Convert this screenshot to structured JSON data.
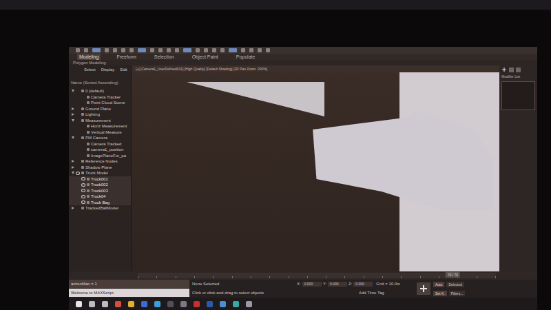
{
  "ribbon": {
    "tabs": [
      {
        "label": "Modeling",
        "selected": true
      },
      {
        "label": "Freeform",
        "selected": false
      },
      {
        "label": "Selection",
        "selected": false
      },
      {
        "label": "Object Paint",
        "selected": false
      },
      {
        "label": "Populate",
        "selected": false
      }
    ],
    "subtitle": "Polygon Modeling"
  },
  "scene_explorer": {
    "menu": [
      "Select",
      "Display",
      "Edit"
    ],
    "header": "Name (Sorted Ascending)",
    "items": [
      {
        "label": "0 (default)",
        "depth": 0,
        "expandable": true,
        "expanded": true,
        "selected": false,
        "visible": false
      },
      {
        "label": "Camera Tracker",
        "depth": 1,
        "expandable": false,
        "expanded": false,
        "selected": false,
        "visible": false
      },
      {
        "label": "Point Cloud Scene",
        "depth": 1,
        "expandable": false,
        "expanded": false,
        "selected": false,
        "visible": false
      },
      {
        "label": "Ground Plane",
        "depth": 0,
        "expandable": true,
        "expanded": false,
        "selected": false,
        "visible": false
      },
      {
        "label": "Lighting",
        "depth": 0,
        "expandable": true,
        "expanded": false,
        "selected": false,
        "visible": false
      },
      {
        "label": "Measurement",
        "depth": 0,
        "expandable": true,
        "expanded": true,
        "selected": false,
        "visible": false
      },
      {
        "label": "Horiz Measurement",
        "depth": 1,
        "expandable": false,
        "expanded": false,
        "selected": false,
        "visible": false
      },
      {
        "label": "Vertical Measure",
        "depth": 1,
        "expandable": false,
        "expanded": false,
        "selected": false,
        "visible": false
      },
      {
        "label": "PM Camera",
        "depth": 0,
        "expandable": true,
        "expanded": true,
        "selected": false,
        "visible": false
      },
      {
        "label": "Camera Tracked",
        "depth": 1,
        "expandable": false,
        "expanded": false,
        "selected": false,
        "visible": false
      },
      {
        "label": "camera1_position",
        "depth": 1,
        "expandable": false,
        "expanded": false,
        "selected": false,
        "visible": false
      },
      {
        "label": "ImagePlaneFor_pa",
        "depth": 1,
        "expandable": false,
        "expanded": false,
        "selected": false,
        "visible": false
      },
      {
        "label": "Reference Nodes",
        "depth": 0,
        "expandable": true,
        "expanded": false,
        "selected": false,
        "visible": false
      },
      {
        "label": "Shadow Plane",
        "depth": 0,
        "expandable": true,
        "expanded": false,
        "selected": false,
        "visible": false
      },
      {
        "label": "Truck Model",
        "depth": 0,
        "expandable": true,
        "expanded": true,
        "selected": false,
        "visible": true
      },
      {
        "label": "Truck001",
        "depth": 1,
        "expandable": false,
        "expanded": false,
        "selected": true,
        "visible": true
      },
      {
        "label": "Truck002",
        "depth": 1,
        "expandable": false,
        "expanded": false,
        "selected": true,
        "visible": true
      },
      {
        "label": "Truck003",
        "depth": 1,
        "expandable": false,
        "expanded": false,
        "selected": true,
        "visible": true
      },
      {
        "label": "Truck04",
        "depth": 1,
        "expandable": false,
        "expanded": false,
        "selected": true,
        "visible": true
      },
      {
        "label": "Truck Bag",
        "depth": 1,
        "expandable": false,
        "expanded": false,
        "selected": true,
        "visible": true
      },
      {
        "label": "TrackedBallModel",
        "depth": 0,
        "expandable": true,
        "expanded": false,
        "selected": false,
        "visible": false
      }
    ]
  },
  "viewport": {
    "label": "[+] [Camera1_UserDefined001] [High Quality] [Default Shading] [2D Pan Zoom: 200%]"
  },
  "command_panel": {
    "heading": "Modifier List"
  },
  "timeline": {
    "frame": "70 / 70",
    "level": 0.9
  },
  "listener": {
    "lines": [
      "actionMan = 1",
      "Welcome to MAXScript."
    ]
  },
  "status": {
    "selection": "None Selected",
    "prompt": "Click or click-and-drag to select objects",
    "x_label": "X:",
    "y_label": "Y:",
    "z_label": "Z:",
    "x": "0.000",
    "y": "0.000",
    "z": "0.000",
    "grid": "Grid = 10.0in",
    "time_tag": "Add Time Tag"
  },
  "animation": {
    "auto": "Auto",
    "mode": "Selected",
    "set_key": "Set K.",
    "filters": "Filters..."
  },
  "taskbar": {
    "apps": [
      {
        "name": "start",
        "color": "#e6e4ec"
      },
      {
        "name": "search",
        "color": "#bdbac4"
      },
      {
        "name": "task-view",
        "color": "#bdbac4"
      },
      {
        "name": "chrome",
        "color": "#d4503c"
      },
      {
        "name": "explorer",
        "color": "#e0b034"
      },
      {
        "name": "store",
        "color": "#3c6ad6"
      },
      {
        "name": "skype",
        "color": "#3aa0dc"
      },
      {
        "name": "terminal",
        "color": "#50505a"
      },
      {
        "name": "calculator",
        "color": "#7a7a86"
      },
      {
        "name": "filezilla",
        "color": "#c83030"
      },
      {
        "name": "word",
        "color": "#2d5aa8"
      },
      {
        "name": "photos",
        "color": "#4a8fd0"
      },
      {
        "name": "max",
        "color": "#3aa8a0"
      },
      {
        "name": "settings",
        "color": "#9a9aa6"
      }
    ]
  }
}
